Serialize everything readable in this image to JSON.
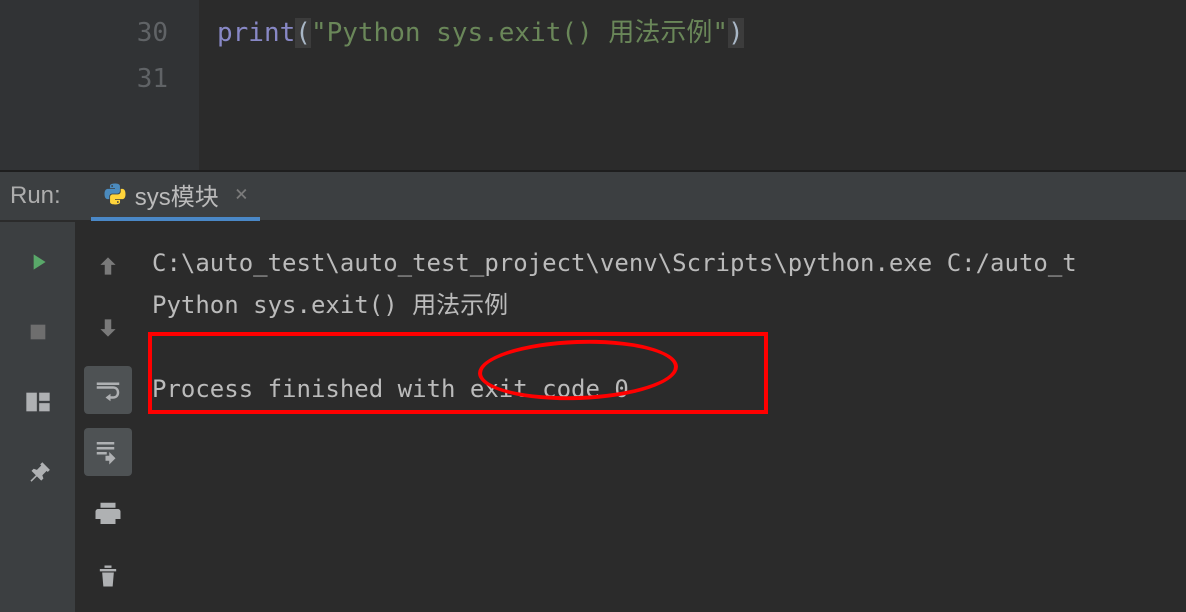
{
  "editor": {
    "lines": [
      {
        "num": "30"
      },
      {
        "num": "31"
      }
    ],
    "code": {
      "func": "print",
      "lparen": "(",
      "string": "\"Python sys.exit() 用法示例\"",
      "rparen": ")"
    }
  },
  "run_panel": {
    "label": "Run:",
    "tab": {
      "name": "sys模块",
      "close": "×"
    }
  },
  "console": {
    "line1": "C:\\auto_test\\auto_test_project\\venv\\Scripts\\python.exe C:/auto_t",
    "line2": "Python sys.exit() 用法示例",
    "blank": " ",
    "line3": "Process finished with exit code 0"
  }
}
